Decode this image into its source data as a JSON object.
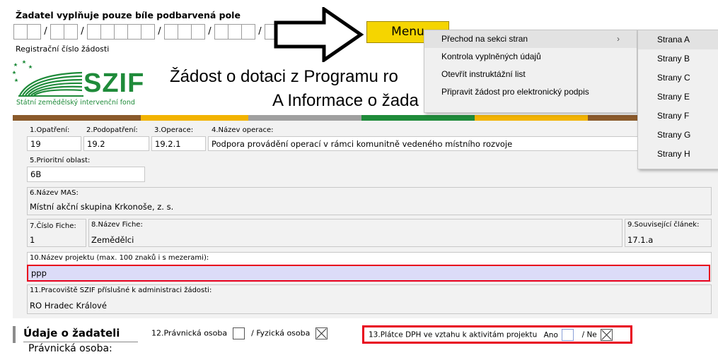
{
  "header": {
    "instruction": "Žadatel vyplňuje pouze bíle podbarvená pole",
    "reg_label": "Registrační číslo žádosti",
    "menu_label": "Menu"
  },
  "logo": {
    "text": "SZIF",
    "subtitle": "Státní zemědělský intervenční fond"
  },
  "title": {
    "line1": "Žádost o dotaci z Programu ro",
    "line2": "A Informace o žada"
  },
  "form": {
    "f1_label": "1.Opatření:",
    "f1_value": "19",
    "f2_label": "2.Podopatření:",
    "f2_value": "19.2",
    "f3_label": "3.Operace:",
    "f3_value": "19.2.1",
    "f4_label": "4.Název operace:",
    "f4_value": "Podpora provádění operací v rámci komunitně vedeného místního rozvoje",
    "f5_label": "5.Prioritní oblast:",
    "f5_value": "6B",
    "f6_label": "6.Název MAS:",
    "f6_value": "Místní akční skupina Krkonoše, z. s.",
    "f7_label": "7.Číslo Fiche:",
    "f7_value": "1",
    "f8_label": "8.Název Fiche:",
    "f8_value": "Zemědělci",
    "f9_label": "9.Související článek:",
    "f9_value": "17.1.a",
    "f10_label": "10.Název projektu (max. 100 znaků i s mezerami):",
    "f10_value": "ppp",
    "f11_label": "11.Pracoviště SZIF příslušné k administraci žádosti:",
    "f11_value": "RO Hradec Králové"
  },
  "applicant": {
    "section_title": "Údaje o žadateli",
    "f12_label": "12.Právnická osoba",
    "f12_sep": "/ Fyzická osoba",
    "f13_label": "13.Plátce DPH ve vztahu k aktivitám projektu",
    "f13_yes": "Ano",
    "f13_no": "/ Ne",
    "person_type": "Právnická osoba:"
  },
  "menu": {
    "items": [
      {
        "label": "Přechod na sekci stran",
        "arrow": "›"
      },
      {
        "label": "Kontrola vyplněných údajů"
      },
      {
        "label": "Otevřít instruktážní list"
      },
      {
        "label": "Připravit žádost pro elektronický podpis"
      }
    ],
    "submenu": [
      "Strana A",
      "Strany B",
      "Strany C",
      "Strany E",
      "Strany F",
      "Strany G",
      "Strany H"
    ]
  },
  "colors": {
    "stripes": [
      "#8a5a2b",
      "#f2b300",
      "#a0a0a0",
      "#1f8b3a",
      "#f2b300",
      "#8a5a2b"
    ],
    "highlight": "#e8001c",
    "input_highlight": "#dcdcf8",
    "logo_green": "#1f8b3a"
  }
}
